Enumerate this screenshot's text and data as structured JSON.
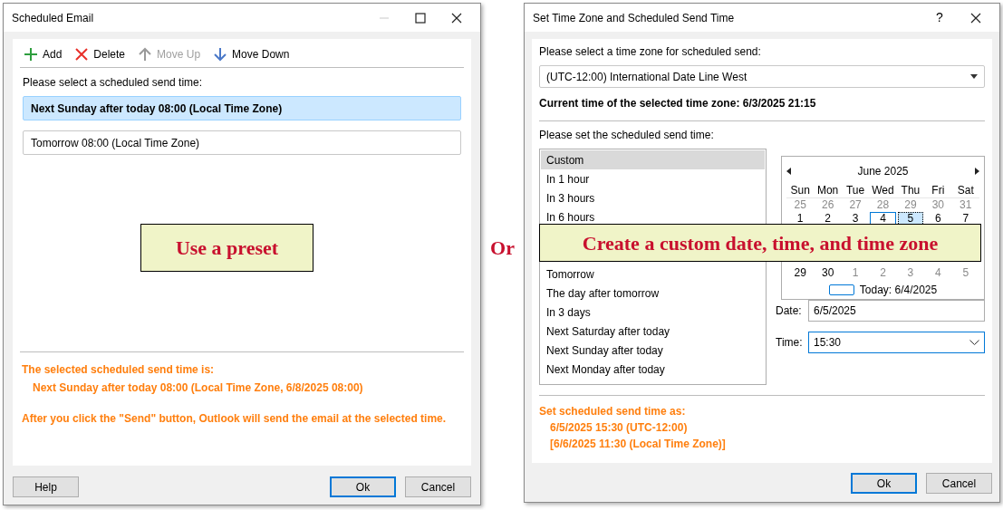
{
  "left_dialog": {
    "title": "Scheduled Email",
    "window_buttons": [
      {
        "kind": "minimize",
        "disabled": true
      },
      {
        "kind": "maximize",
        "disabled": false
      },
      {
        "kind": "close",
        "disabled": false
      }
    ],
    "toolbar": [
      {
        "kind": "add",
        "label": "Add",
        "disabled": false
      },
      {
        "kind": "delete",
        "label": "Delete",
        "disabled": false
      },
      {
        "kind": "up",
        "label": "Move Up",
        "disabled": true
      },
      {
        "kind": "down",
        "label": "Move Down",
        "disabled": false
      }
    ],
    "prompt": "Please select a scheduled send time:",
    "presets": [
      {
        "label": "Next Sunday after today 08:00 (Local Time Zone)",
        "selected": true
      },
      {
        "label": "Tomorrow 08:00 (Local Time Zone)",
        "selected": false
      }
    ],
    "summary": {
      "heading": "The selected scheduled send time is:",
      "detail": "Next Sunday after today 08:00 (Local Time Zone, 6/8/2025 08:00)"
    },
    "note": "After you click the \"Send\" button, Outlook will send the email at the selected time.",
    "buttons": [
      {
        "label": "Help",
        "default": false
      },
      {
        "label": "Ok",
        "default": true
      },
      {
        "label": "Cancel",
        "default": false
      }
    ],
    "callout": "Use a preset"
  },
  "separator_text": "Or",
  "right_dialog": {
    "title": "Set Time Zone and Scheduled Send Time",
    "window_buttons": [
      {
        "kind": "help",
        "label": "?"
      },
      {
        "kind": "close",
        "disabled": false
      }
    ],
    "timezone_prompt": "Please select a time zone for scheduled send:",
    "timezone": "(UTC-12:00) International Date Line West",
    "current_time": "Current time of the selected time zone: 6/3/2025 21:15",
    "send_prompt": "Please set the scheduled send time:",
    "options_top": [
      {
        "label": "Custom",
        "selected": true
      },
      {
        "label": "In 1 hour",
        "selected": false
      },
      {
        "label": "In 3 hours",
        "selected": false
      },
      {
        "label": "In 6 hours",
        "selected": false
      }
    ],
    "options_bottom": [
      {
        "label": "Tomorrow",
        "selected": false
      },
      {
        "label": "The day after tomorrow",
        "selected": false
      },
      {
        "label": "In 3 days",
        "selected": false
      },
      {
        "label": "Next Saturday after today",
        "selected": false
      },
      {
        "label": "Next Sunday after today",
        "selected": false
      },
      {
        "label": "Next Monday after today",
        "selected": false
      }
    ],
    "calendar": {
      "month": "June 2025",
      "weekdays": [
        "Sun",
        "Mon",
        "Tue",
        "Wed",
        "Thu",
        "Fri",
        "Sat"
      ],
      "weeks_top": [
        [
          {
            "day": "25",
            "muted": true,
            "today": false,
            "selected": false
          },
          {
            "day": "26",
            "muted": true,
            "today": false,
            "selected": false
          },
          {
            "day": "27",
            "muted": true,
            "today": false,
            "selected": false
          },
          {
            "day": "28",
            "muted": true,
            "today": false,
            "selected": false
          },
          {
            "day": "29",
            "muted": true,
            "today": false,
            "selected": false
          },
          {
            "day": "30",
            "muted": true,
            "today": false,
            "selected": false
          },
          {
            "day": "31",
            "muted": true,
            "today": false,
            "selected": false
          }
        ],
        [
          {
            "day": "1",
            "muted": false,
            "today": false,
            "selected": false
          },
          {
            "day": "2",
            "muted": false,
            "today": false,
            "selected": false
          },
          {
            "day": "3",
            "muted": false,
            "today": false,
            "selected": false
          },
          {
            "day": "4",
            "muted": false,
            "today": true,
            "selected": false
          },
          {
            "day": "5",
            "muted": false,
            "today": false,
            "selected": true
          },
          {
            "day": "6",
            "muted": false,
            "today": false,
            "selected": false
          },
          {
            "day": "7",
            "muted": false,
            "today": false,
            "selected": false
          }
        ]
      ],
      "weeks_bottom": [
        [
          {
            "day": "29",
            "muted": false,
            "today": false,
            "selected": false
          },
          {
            "day": "30",
            "muted": false,
            "today": false,
            "selected": false
          },
          {
            "day": "1",
            "muted": true,
            "today": false,
            "selected": false
          },
          {
            "day": "2",
            "muted": true,
            "today": false,
            "selected": false
          },
          {
            "day": "3",
            "muted": true,
            "today": false,
            "selected": false
          },
          {
            "day": "4",
            "muted": true,
            "today": false,
            "selected": false
          },
          {
            "day": "5",
            "muted": true,
            "today": false,
            "selected": false
          }
        ]
      ],
      "today_label": "Today: 6/4/2025"
    },
    "date": {
      "label": "Date:",
      "value": "6/5/2025",
      "focused": false
    },
    "time": {
      "label": "Time:",
      "value": "15:30",
      "focused": true
    },
    "result": {
      "heading": "Set scheduled send time as:",
      "lines": [
        "6/5/2025 15:30 (UTC-12:00)",
        "[6/6/2025 11:30 (Local Time Zone)]"
      ]
    },
    "buttons": [
      {
        "label": "Ok",
        "default": true
      },
      {
        "label": "Cancel",
        "default": false
      }
    ],
    "callout": "Create a custom date, time, and time zone"
  }
}
